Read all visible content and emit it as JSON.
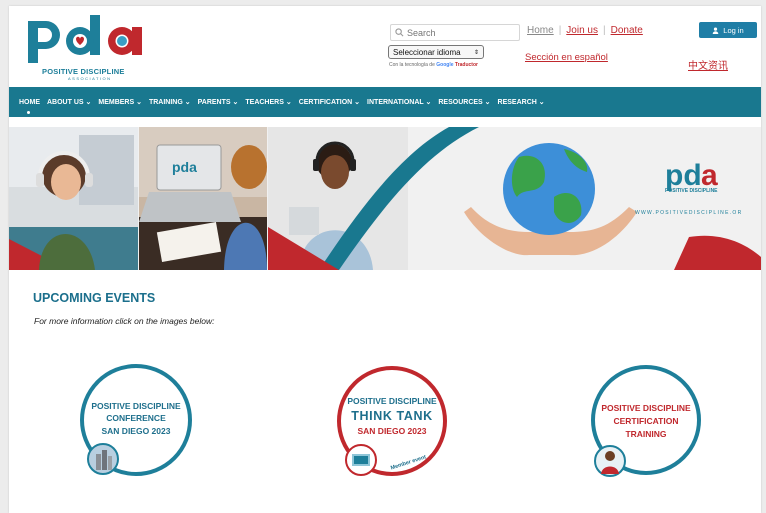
{
  "logo": {
    "letters": "pda",
    "sub": "POSITIVE DISCIPLINE",
    "sub2": "ASSOCIATION"
  },
  "header": {
    "search_placeholder": "Search",
    "links": {
      "home": "Home",
      "join": "Join us",
      "donate": "Donate",
      "separator": "|"
    },
    "login_label": "Log in",
    "language_select": "Seleccionar idioma",
    "powered_prefix": "Con la tecnología de",
    "powered_google": "Google",
    "powered_translator": "Traductor",
    "spanish_section": "Sección en español",
    "chinese_section": "中文资讯"
  },
  "nav": {
    "items": [
      {
        "label": "HOME"
      },
      {
        "label": "ABOUT US ⌄"
      },
      {
        "label": "MEMBERS ⌄"
      },
      {
        "label": "TRAINING ⌄"
      },
      {
        "label": "PARENTS ⌄"
      },
      {
        "label": "TEACHERS ⌄"
      },
      {
        "label": "CERTIFICATION ⌄"
      },
      {
        "label": "INTERNATIONAL ⌄"
      },
      {
        "label": "RESOURCES ⌄"
      },
      {
        "label": "RESEARCH ⌄"
      }
    ]
  },
  "banner": {
    "logo_letters": "pda",
    "logo_sub": "POSITIVE DISCIPLINE",
    "url": "WWW.POSITIVEDISCIPLINE.OR"
  },
  "events": {
    "title": "UPCOMING EVENTS",
    "subtitle": "For more information click on the images below:",
    "items": [
      {
        "line1": "POSITIVE DISCIPLINE",
        "line2": "CONFERENCE",
        "line3": "SAN DIEGO 2023"
      },
      {
        "line1": "POSITIVE DISCIPLINE",
        "line2": "THINK TANK",
        "line3": "SAN DIEGO 2023",
        "badge": "Member event"
      },
      {
        "line1": "POSITIVE DISCIPLINE",
        "line2": "CERTIFICATION",
        "line3": "TRAINING"
      }
    ]
  },
  "colors": {
    "brand_red": "#c0282d",
    "brand_teal": "#19788f",
    "login_blue": "#1f7ea6"
  }
}
